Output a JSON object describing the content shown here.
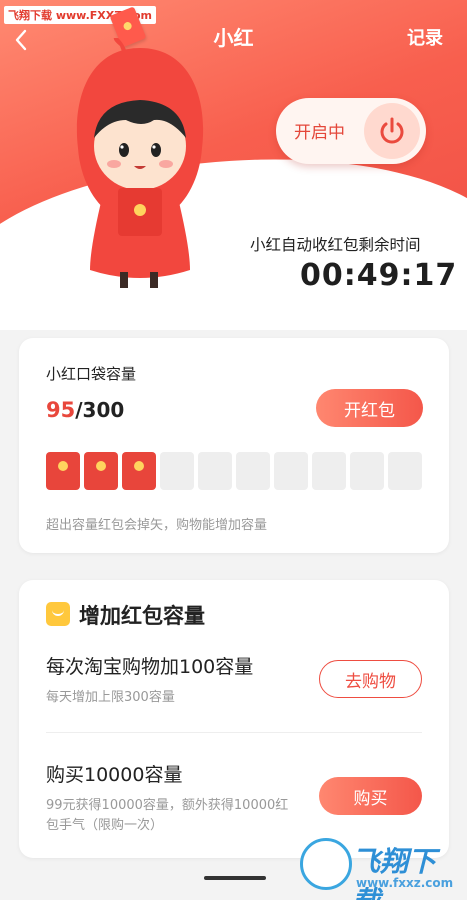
{
  "watermark": "飞翔下载 www.FXXZ.com",
  "header": {
    "back_label": "‹",
    "title": "小红",
    "record_label": "记录"
  },
  "toggle": {
    "label": "开启中",
    "icon": "power-icon"
  },
  "timer": {
    "label": "小红自动收红包剩余时间",
    "value": "00:49:17"
  },
  "capacity": {
    "title": "小红口袋容量",
    "current": "95",
    "total": "/300",
    "open_button": "开红包",
    "slots_total": 10,
    "slots_filled": 3,
    "note": "超出容量红包会掉矢，购物能增加容量"
  },
  "increase": {
    "title": "增加红包容量",
    "items": [
      {
        "title": "每次淘宝购物加100容量",
        "sub": "每天增加上限300容量",
        "button": "去购物"
      },
      {
        "title": "购买10000容量",
        "sub": "99元获得10000容量，额外获得10000红包手气（限购一次）",
        "button": "购买"
      }
    ]
  },
  "logo": {
    "text": "飞翔下载",
    "url": "www.fxxz.com"
  },
  "colors": {
    "accent": "#f4574a",
    "hero": "#ee4c43",
    "coin": "#ffd45e"
  }
}
